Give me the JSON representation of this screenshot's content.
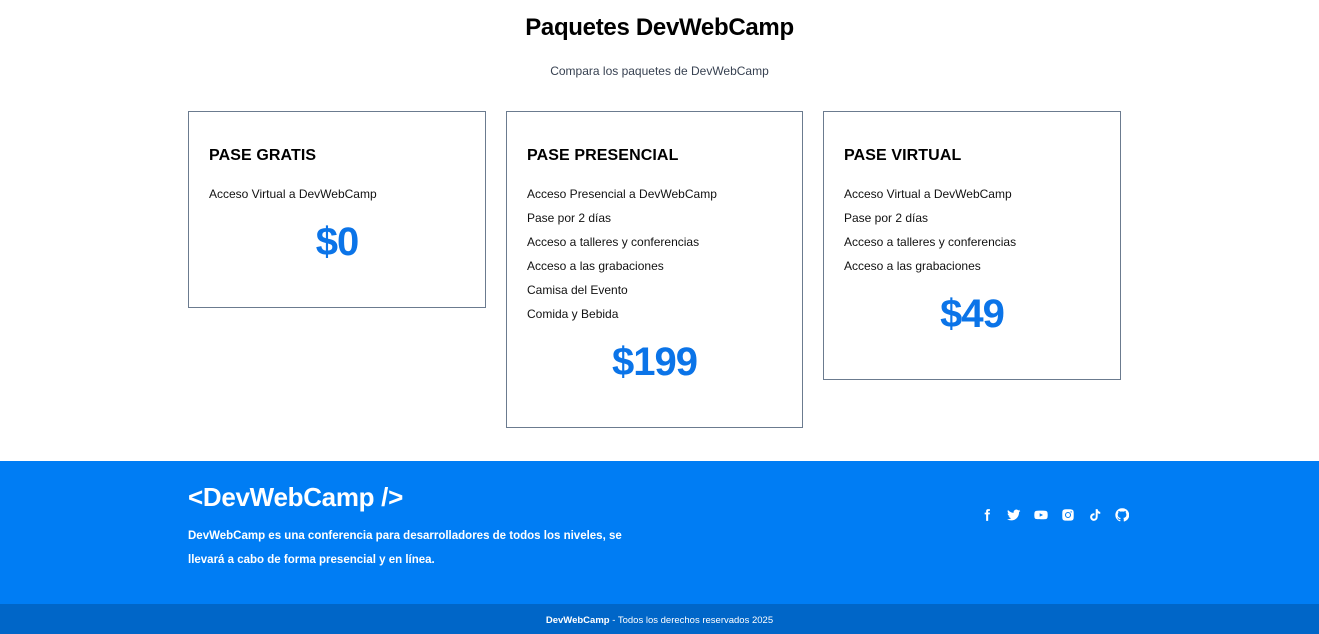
{
  "page": {
    "title": "Paquetes DevWebCamp",
    "subtitle": "Compara los paquetes de DevWebCamp"
  },
  "packages": [
    {
      "name": "PASE GRATIS",
      "features": [
        "Acceso Virtual a DevWebCamp"
      ],
      "price": "$0"
    },
    {
      "name": "PASE PRESENCIAL",
      "features": [
        "Acceso Presencial a DevWebCamp",
        "Pase por 2 días",
        "Acceso a talleres y conferencias",
        "Acceso a las grabaciones",
        "Camisa del Evento",
        "Comida y Bebida"
      ],
      "price": "$199"
    },
    {
      "name": "PASE VIRTUAL",
      "features": [
        "Acceso Virtual a DevWebCamp",
        "Pase por 2 días",
        "Acceso a talleres y conferencias",
        "Acceso a las grabaciones"
      ],
      "price": "$49"
    }
  ],
  "footer": {
    "logo": "<DevWebCamp />",
    "description": "DevWebCamp es una conferencia para desarrolladores de todos los niveles, se llevará a cabo de forma presencial y en línea.",
    "social_icons": [
      "facebook-icon",
      "twitter-icon",
      "youtube-icon",
      "instagram-icon",
      "tiktok-icon",
      "github-icon"
    ],
    "copyright_brand": "DevWebCamp",
    "copyright_text": " - Todos los derechos reservados 2025"
  },
  "colors": {
    "accent": "#007df4",
    "price": "#0b74e8",
    "footer_bottom": "#0066c8"
  }
}
